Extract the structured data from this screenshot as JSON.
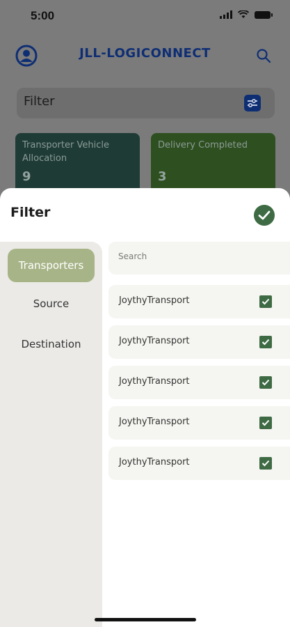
{
  "status_bar": {
    "time": "5:00"
  },
  "app_bar": {
    "title": "JLL-LOGICONNECT"
  },
  "filter_bar": {
    "label": "Filter"
  },
  "cards": [
    {
      "label": "Transporter Vehicle Allocation",
      "value": "9"
    },
    {
      "label": "Delivery Completed",
      "value": "3"
    }
  ],
  "sheet": {
    "title": "Filter",
    "tabs": [
      {
        "label": "Transporters",
        "active": true
      },
      {
        "label": "Source",
        "active": false
      },
      {
        "label": "Destination",
        "active": false
      }
    ],
    "search": {
      "placeholder": "Search",
      "value": ""
    },
    "items": [
      {
        "label": "JoythyTransport",
        "checked": true
      },
      {
        "label": "JoythyTransport",
        "checked": true
      },
      {
        "label": "JoythyTransport",
        "checked": true
      },
      {
        "label": "JoythyTransport",
        "checked": true
      },
      {
        "label": "JoythyTransport",
        "checked": true
      }
    ]
  },
  "colors": {
    "brand": "#0e2e74",
    "accent_green": "#3e6b44",
    "active_tab": "#a7b487"
  }
}
